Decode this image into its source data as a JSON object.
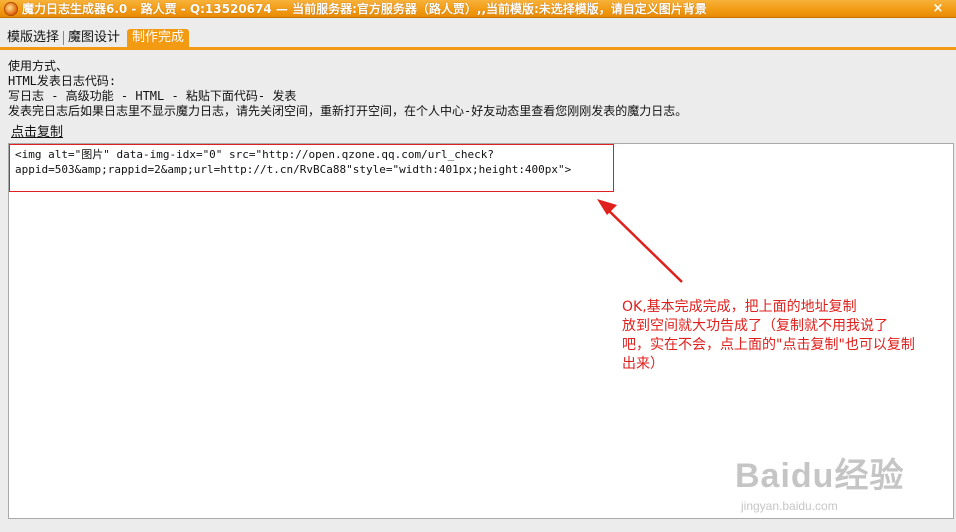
{
  "window": {
    "title": "魔力日志生成器6.0 - 路人贾 - Q:13520674 — 当前服务器:官方服务器（路人贾）,,当前模版:未选择模版，请自定义图片背景",
    "close_glyph": "×"
  },
  "tabs": [
    {
      "label": "模版选择",
      "active": false
    },
    {
      "label": "魔图设计",
      "active": false
    },
    {
      "label": "制作完成",
      "active": true
    }
  ],
  "instructions": {
    "lines": [
      "使用方式、",
      "HTML发表日志代码:",
      "写日志 - 高级功能 - HTML - 粘贴下面代码- 发表",
      "发表完日志后如果日志里不显示魔力日志，请先关闭空间，重新打开空间，在个人中心-好友动态里查看您刚刚发表的魔力日志。"
    ],
    "copy_link": "点击复制"
  },
  "code": {
    "line1": "<img alt=\"图片\" data-img-idx=\"0\" src=\"http://open.qzone.qq.com/url_check?",
    "line2": "appid=503&amp;rappid=2&amp;url=http://t.cn/RvBCa88\"style=\"width:401px;height:400px\">"
  },
  "annotation": {
    "lines": [
      "OK,基本完成完成，把上面的地址复制",
      "放到空间就大功告成了（复制就不用我说了",
      "吧，实在不会，点上面的\"点击复制\"也可以复制",
      "出来）"
    ],
    "color": "#e0201c"
  },
  "watermark": {
    "logo": "Baidu经验",
    "url": "jingyan.baidu.com"
  },
  "colors": {
    "accent": "#f29a12",
    "highlight_border": "#e02020"
  }
}
